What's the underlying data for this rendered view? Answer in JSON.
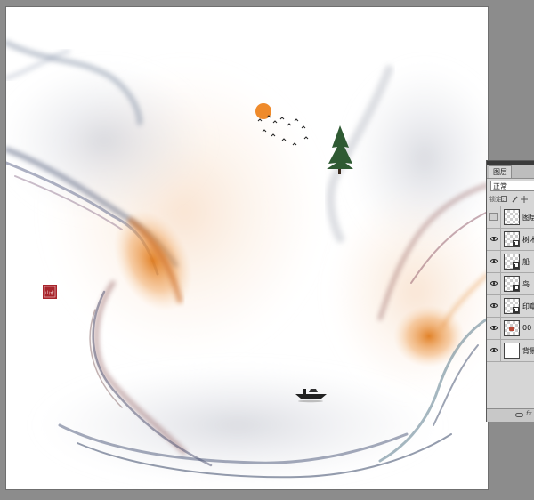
{
  "canvas": {
    "seal_text": "山水中國",
    "seal_color": "#a8242b",
    "ink_colors": [
      "#3c4a6a",
      "#e07c1e",
      "#7a3b3b",
      "#5b7b8c"
    ]
  },
  "layers_panel": {
    "tab_label": "图层",
    "blend_mode": "正常",
    "lock_label": "锁定:",
    "layers": [
      {
        "name": "图层",
        "visible": false,
        "thumb": "transparent"
      },
      {
        "name": "树木",
        "visible": true,
        "thumb": "smart-object"
      },
      {
        "name": "船",
        "visible": true,
        "thumb": "smart-object"
      },
      {
        "name": "鸟",
        "visible": true,
        "thumb": "smart-object"
      },
      {
        "name": "印章",
        "visible": true,
        "thumb": "smart-object"
      },
      {
        "name": "00",
        "visible": true,
        "thumb": "transparent-red"
      },
      {
        "name": "背景",
        "visible": true,
        "thumb": "white"
      }
    ],
    "footer_fx": "fx"
  }
}
